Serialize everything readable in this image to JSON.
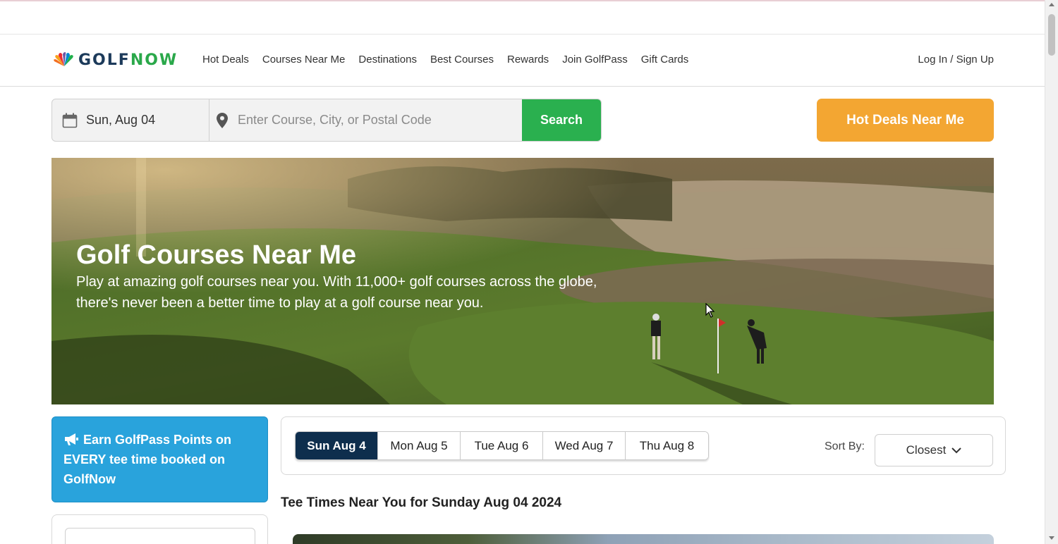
{
  "brand": {
    "logo_part1": "GOLF",
    "logo_part2": "NOW",
    "colors": {
      "navy": "#1c3a5a",
      "green": "#2aa84a",
      "search_green": "#2ab04f",
      "orange": "#f3a632",
      "promo_blue": "#29a3dc",
      "active_tab": "#0e2e4d"
    }
  },
  "nav": {
    "items": [
      "Hot Deals",
      "Courses Near Me",
      "Destinations",
      "Best Courses",
      "Rewards",
      "Join GolfPass",
      "Gift Cards"
    ],
    "login": "Log In / Sign Up"
  },
  "search": {
    "date": "Sun, Aug 04",
    "location_placeholder": "Enter Course, City, or Postal Code",
    "location_value": "",
    "button": "Search",
    "calendar_icon": "calendar-icon",
    "location_icon": "map-pin-icon"
  },
  "hot_deals_button": "Hot Deals Near Me",
  "hero": {
    "title": "Golf Courses Near Me",
    "description": "Play at amazing golf courses near you. With 11,000+ golf courses across the globe, there's never been a better time to play at a golf course near you."
  },
  "promo": {
    "icon": "megaphone-icon",
    "text": "Earn GolfPass Points on EVERY tee time booked on GolfNow"
  },
  "days": {
    "tabs": [
      "Sun Aug 4",
      "Mon Aug 5",
      "Tue Aug 6",
      "Wed Aug 7",
      "Thu Aug 8"
    ],
    "active_index": 0
  },
  "sort": {
    "label": "Sort By:",
    "selected": "Closest"
  },
  "tee_times": {
    "heading": "Tee Times Near You for Sunday Aug 04 2024"
  }
}
